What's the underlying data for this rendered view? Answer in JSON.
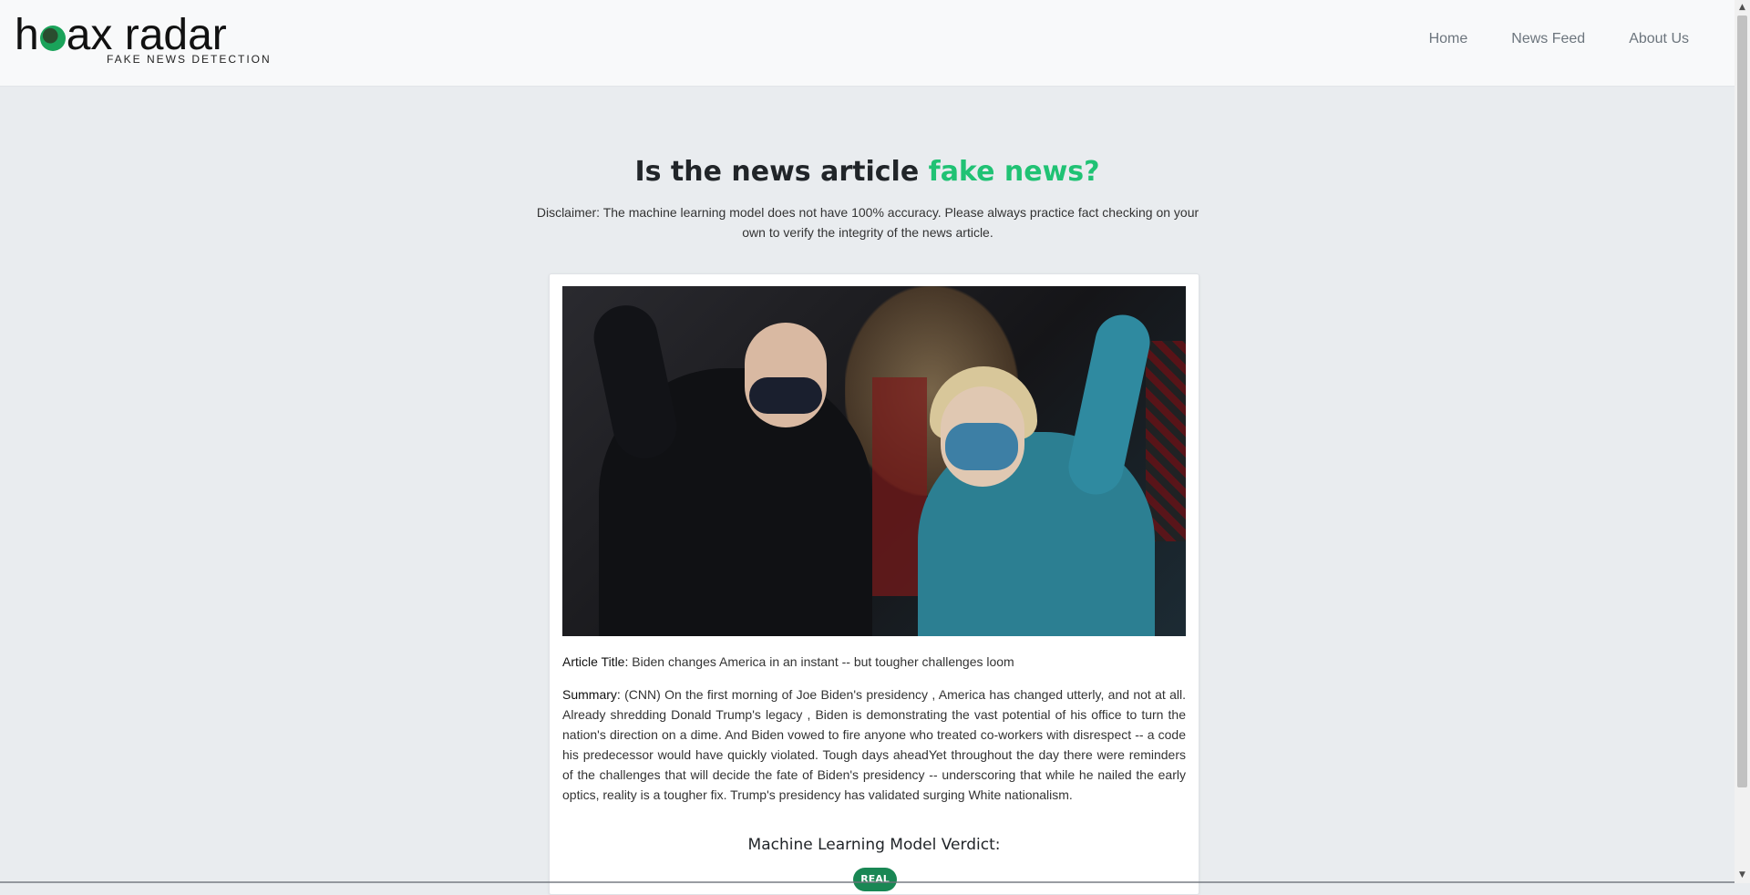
{
  "header": {
    "logo": {
      "text_before": "h",
      "text_after": "ax radar",
      "subtitle": "FAKE NEWS DETECTION"
    },
    "nav": [
      {
        "label": "Home"
      },
      {
        "label": "News Feed"
      },
      {
        "label": "About Us"
      }
    ]
  },
  "main": {
    "heading": {
      "plain": "Is the news article ",
      "accent": "fake news?"
    },
    "disclaimer": "Disclaimer: The machine learning model does not have 100% accuracy. Please always practice fact checking on your own to verify the integrity of the news article."
  },
  "article": {
    "title_label": "Article Title:",
    "title_value": "Biden changes America in an instant -- but tougher challenges loom",
    "summary_label": "Summary:",
    "summary_value": "(CNN) On the first morning of Joe Biden's presidency , America has changed utterly, and not at all. Already shredding Donald Trump's legacy , Biden is demonstrating the vast potential of his office to turn the nation's direction on a dime. And Biden vowed to fire anyone who treated co-workers with disrespect -- a code his predecessor would have quickly violated. Tough days aheadYet throughout the day there were reminders of the challenges that will decide the fate of Biden's presidency -- underscoring that while he nailed the early optics, reality is a tougher fix. Trump's presidency has validated surging White nationalism."
  },
  "verdict": {
    "title": "Machine Learning Model Verdict:",
    "badge": "REAL",
    "badge_color": "#198754"
  },
  "colors": {
    "accent": "#20c274",
    "background": "#e9ecef",
    "topbar": "#f8f9fa"
  }
}
